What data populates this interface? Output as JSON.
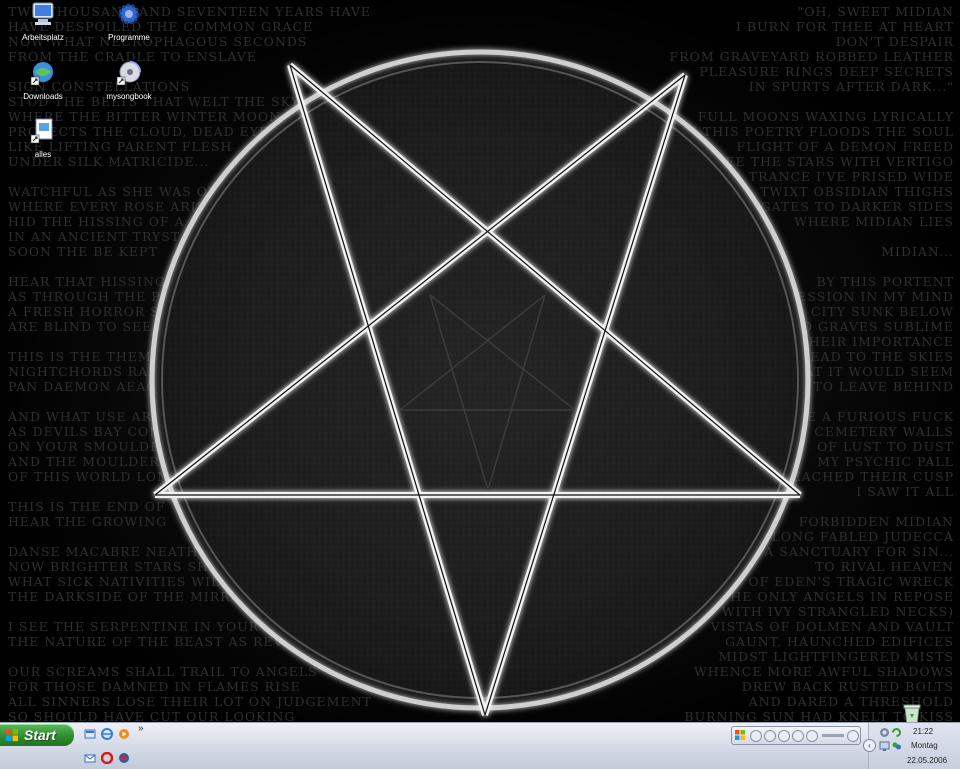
{
  "desktop_icons": [
    {
      "name": "Arbeitsplatz",
      "icon": "my-computer-icon"
    },
    {
      "name": "Programme",
      "icon": "programs-gear-icon"
    },
    {
      "name": "Downloads",
      "icon": "downloads-shortcut-icon"
    },
    {
      "name": "mysongbook",
      "icon": "mysongbook-disc-icon"
    },
    {
      "name": "alles",
      "icon": "file-shortcut-icon"
    }
  ],
  "wallpaper": {
    "left_text": "TWO THOUSAND AND SEVENTEEN YEARS HAVE\nHAVE DESPOILED THE COMMON GRACE\nNOW WHAT NECROPHAGOUS SECONDS\nFROM THE CRADLE TO ENSLAVE\n\nSIGN CONSTELLATIONS\nSTUD THE BELTS THAT WELT THE SKY\nWHERE THE BITTER WINTER MOON\nPROTECTS THE CLOUD, DEAD EYED\nLIKE LIFTING PARENT FLESH\nUNDER SILK MATRICIDE...\n\nWATCHFUL AS SHE WAS ONCE\nWHERE EVERY ROSE ARISE\nHID THE HISSING OF A SERPENT\nIN AN ANCIENT TRYST\nSOON THE BE KEPT\n\nHEAR THAT HISSING\nAS THROUGH THE PLUMES\nA FRESH HORROR SEEPS\nARE BLIND TO SEE THE\n\nTHIS IS THE THEME TO\nNIGHTCHORDS RAPTURE\nPAN DAEMON AEAON\n\nAND WHAT USE ARE\nAS DEVILS BAY CONCEIVED\nON YOUR SMOULDERING\nAND THE MOULDERING\nOF THIS WORLD LONG\n\nTHIS IS THE END OF\nHEAR THE GROWING\n\nDANSE MACABRE NEATH\nNOW BRIGHTER STARS SHALL\nWHAT SICK NATIVITIES WILL\nTHE DARKSIDE OF THE MIRROR\n\nI SEE THE SERPENTINE IN YOUR EYES\nTHE NATURE OF THE BEAST AS REVEALED\n\nOUR SCREAMS SHALL TRAIL TO ANGELS\nFOR THOSE DAMNED IN FLAMES RISE\nALL SINNERS LOSE THEIR LOT ON JUDGEMENT\nSO SHOULD HAVE CUT OUR LOOKING",
    "right_text": "\"OH, SWEET MIDIAN\nI BURN FOR THEE AT HEART\nDON'T DESPAIR\nFROM GRAVEYARD ROBBED LEATHER\nPLEASURE RINGS DEEP SECRETS\nIN SPURTS AFTER DARK...\"\n\nFULL MOONS WAXING LYRICALLY\nIN THIS POETRY FLOODS THE SOUL\nFLIGHT OF A DEMON FREED\nSEE THE STARS WITH VERTIGO\nTRANCE I'VE PRISED WIDE\nTWIXT OBSIDIAN THIGHS\nGATES TO DARKER SIDES\nWHERE MIDIAN LIES\n\nMIDIAN...\n\nBY THIS PORTENT\nOBSESSION IN MY MIND\nCITY SUNK BELOW\nAND GRAVES SUBLIME\nTHEIR IMPORTANCE\nSPREAD TO THE SKIES\nTHAT IT WOULD SEEM\nA PLACE TO LEAVE BEHIND\n\nLIKE A FURIOUS FUCK\nCEMETERY WALLS\nOF LUST TO DUST\nMY PSYCHIC PALL\nREACHED THEIR CUSP\nI SAW IT ALL\n\nFORBIDDEN MIDIAN\nLONG FABLED JUDECCA\nA SANCTUARY FOR SIN...\nTO RIVAL HEAVEN\nOF EDEN'S TRAGIC WRECK\nTHE ONLY ANGELS IN REPOSE\nWITH IVY STRANGLED NECKS)\nVISTAS OF DOLMEN AND VAULT\nGAUNT, HAUNCHED EDIFICES\nMIDST LIGHTFINGERED MISTS\nWHENCE MORE AWFUL SHADOWS\nDREW BACK RUSTED BOLTS\nAND DARED A THRESHOLD\nBURNING SUN HAD KNELT TO KISS"
  },
  "taskbar": {
    "start_label": "Start",
    "quick_launch": [
      {
        "icon": "show-desktop-icon"
      },
      {
        "icon": "internet-explorer-icon"
      },
      {
        "icon": "media-player-icon"
      },
      {
        "icon": "outlook-icon"
      },
      {
        "icon": "opera-icon"
      },
      {
        "icon": "real-player-icon"
      }
    ],
    "chevron": "»"
  },
  "tray": {
    "time": "21:22",
    "day": "Montag",
    "date": "22.05.2006"
  },
  "colors": {
    "start_green": "#2f8f2f",
    "taskbar_silver": "#d6dbe8",
    "pentagram_line": "#f2f2f2",
    "wallpaper_text": "#2f2f2f"
  }
}
